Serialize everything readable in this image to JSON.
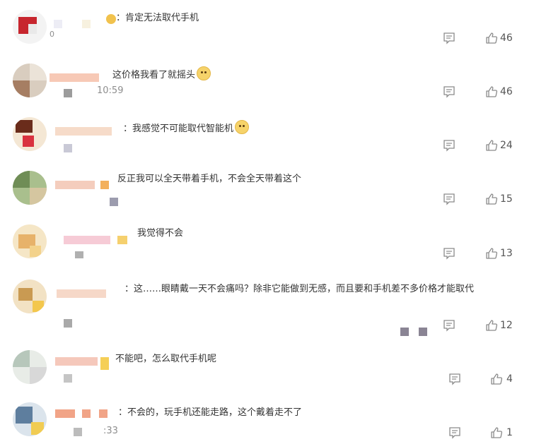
{
  "comments": [
    {
      "text": "：肯定无法取代手机",
      "time": "",
      "likes": "46",
      "emoji": false,
      "time_prefix": "0"
    },
    {
      "text": "这价格我看了就摇头",
      "time": "10:59",
      "likes": "46",
      "emoji": true
    },
    {
      "text": "：我感觉不可能取代智能机",
      "time": "",
      "likes": "24",
      "emoji": true
    },
    {
      "text": "反正我可以全天带着手机，不会全天带着这个",
      "time": "",
      "likes": "15",
      "emoji": false
    },
    {
      "text": "我觉得不会",
      "time": "",
      "likes": "13",
      "emoji": false
    },
    {
      "text": "：这……眼睛戴一天不会痛吗？除非它能做到无感，而且要和手机差不多价格才能取代",
      "time": "",
      "likes": "12",
      "emoji": false
    },
    {
      "text": "不能吧，怎么取代手机呢",
      "time": "",
      "likes": "4",
      "emoji": false
    },
    {
      "text": "：不会的，玩手机还能走路，这个戴着走不了",
      "time": ":33",
      "likes": "1",
      "emoji": false
    }
  ],
  "icons": {
    "reply": "comment-icon",
    "like": "thumbs-up-icon",
    "emoji": "dog-face-emoji"
  }
}
